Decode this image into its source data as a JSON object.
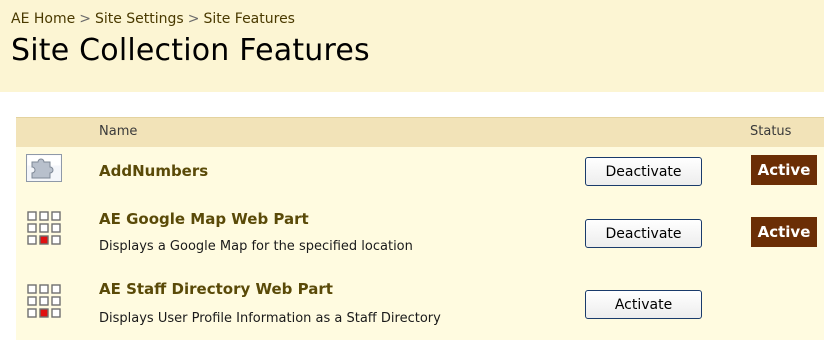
{
  "breadcrumb": {
    "items": [
      "AE Home",
      "Site Settings",
      "Site Features"
    ],
    "separator": ">"
  },
  "page": {
    "title": "Site Collection Features"
  },
  "table": {
    "headers": {
      "name": "Name",
      "status": "Status"
    },
    "features": [
      {
        "name": "AddNumbers",
        "description": "",
        "icon": "puzzle-feature-icon",
        "action_label": "Deactivate",
        "status": "Active"
      },
      {
        "name": "AE Google Map Web Part",
        "description": "Displays a Google Map for the specified location",
        "icon": "web-part-grid-icon",
        "action_label": "Deactivate",
        "status": "Active"
      },
      {
        "name": "AE Staff Directory Web Part",
        "description": "Displays User Profile Information as a Staff Directory",
        "icon": "web-part-grid-icon",
        "action_label": "Activate",
        "status": ""
      }
    ]
  },
  "colors": {
    "title_area_bg": "#fcf5d3",
    "header_row_bg": "#f2e3b8",
    "row_bg": "#fffbe0",
    "feature_title": "#5a4a08",
    "status_badge_bg": "#6b2e05",
    "status_badge_text": "#ffffff",
    "grid_icon_highlight": "#e01010"
  }
}
